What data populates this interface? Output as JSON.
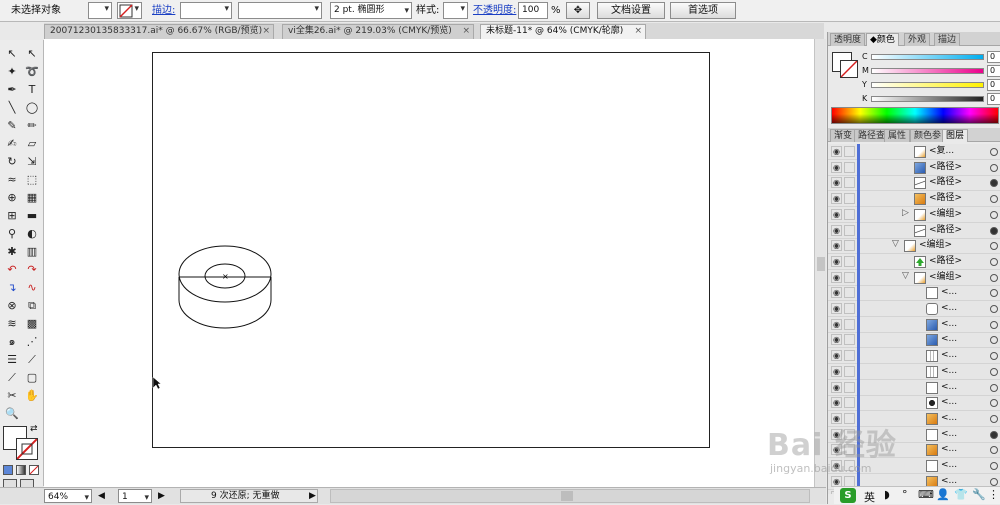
{
  "control_bar": {
    "selection_status": "未选择对象",
    "stroke_label": "描边:",
    "stroke_weight": "",
    "stroke_profile": "",
    "brush_value": "2 pt. 椭圆形",
    "style_label": "样式:",
    "opacity_label": "不透明度:",
    "opacity_value": "100",
    "opacity_unit": "%",
    "doc_setup_button": "文档设置",
    "preferences_button": "首选项"
  },
  "document_tabs": [
    {
      "label": "20071230135833317.ai* @ 66.67% (RGB/预览)",
      "active": false
    },
    {
      "label": "vi全集26.ai* @ 219.03% (CMYK/预览)",
      "active": false
    },
    {
      "label": "未标题-11* @ 64% (CMYK/轮廓)",
      "active": true
    }
  ],
  "tab_close_glyph": "×",
  "tools": [
    {
      "name": "selection-tool-icon",
      "glyph": "↖"
    },
    {
      "name": "direct-selection-tool-icon",
      "glyph": "↖"
    },
    {
      "name": "magic-wand-tool-icon",
      "glyph": "✦"
    },
    {
      "name": "lasso-tool-icon",
      "glyph": "➰"
    },
    {
      "name": "pen-tool-icon",
      "glyph": "✒"
    },
    {
      "name": "type-tool-icon",
      "glyph": "T"
    },
    {
      "name": "line-tool-icon",
      "glyph": "╲"
    },
    {
      "name": "ellipse-tool-icon",
      "glyph": "◯"
    },
    {
      "name": "paintbrush-tool-icon",
      "glyph": "✎"
    },
    {
      "name": "pencil-tool-icon",
      "glyph": "✏"
    },
    {
      "name": "blob-brush-tool-icon",
      "glyph": "✍"
    },
    {
      "name": "eraser-tool-icon",
      "glyph": "▱"
    },
    {
      "name": "rotate-tool-icon",
      "glyph": "↻"
    },
    {
      "name": "scale-tool-icon",
      "glyph": "⇲"
    },
    {
      "name": "warp-tool-icon",
      "glyph": "≈"
    },
    {
      "name": "free-transform-tool-icon",
      "glyph": "⬚"
    },
    {
      "name": "shape-builder-tool-icon",
      "glyph": "⊕"
    },
    {
      "name": "perspective-grid-tool-icon",
      "glyph": "▦"
    },
    {
      "name": "mesh-tool-icon",
      "glyph": "⊞"
    },
    {
      "name": "gradient-tool-icon",
      "glyph": "▬"
    },
    {
      "name": "eyedropper-tool-icon",
      "glyph": "⚲"
    },
    {
      "name": "blend-tool-icon",
      "glyph": "◐"
    },
    {
      "name": "symbol-sprayer-tool-icon",
      "glyph": "✱"
    },
    {
      "name": "column-graph-tool-icon",
      "glyph": "▥"
    },
    {
      "name": "red-shape-tool-icon",
      "glyph": "↶"
    },
    {
      "name": "red-curve-tool-icon",
      "glyph": "↷"
    },
    {
      "name": "blue-path-tool-icon",
      "glyph": "↴"
    },
    {
      "name": "red-wave-tool-icon",
      "glyph": "∿"
    },
    {
      "name": "target-tool-icon",
      "glyph": "⊗"
    },
    {
      "name": "envelope-tool-icon",
      "glyph": "⧉"
    },
    {
      "name": "wave-tool-icon",
      "glyph": "≋"
    },
    {
      "name": "grid-tool-icon",
      "glyph": "▩"
    },
    {
      "name": "spiral-tool-icon",
      "glyph": "๑"
    },
    {
      "name": "wrinkle-tool-icon",
      "glyph": "⋰"
    },
    {
      "name": "list-tool-icon",
      "glyph": "☰"
    },
    {
      "name": "slice-tool-icon",
      "glyph": "⟋"
    },
    {
      "name": "knife-tool-icon",
      "glyph": "⟋"
    },
    {
      "name": "artboard-tool-icon",
      "glyph": "▢"
    },
    {
      "name": "scissors-tool-icon",
      "glyph": "✂"
    },
    {
      "name": "hand-tool-icon",
      "glyph": "✋"
    },
    {
      "name": "zoom-tool-icon",
      "glyph": "🔍"
    }
  ],
  "panel_top_tabs": [
    "透明度",
    "颜色",
    "外观",
    "描边"
  ],
  "panel_top_active": 1,
  "color_channels": [
    {
      "label": "C",
      "value": "0",
      "color": "#00aeef"
    },
    {
      "label": "M",
      "value": "0",
      "color": "#ec008c"
    },
    {
      "label": "Y",
      "value": "0",
      "color": "#fff200"
    },
    {
      "label": "K",
      "value": "0",
      "color": "#222222"
    }
  ],
  "channel_unit": "%",
  "panel_lower_tabs": [
    "渐变",
    "路径查",
    "属性",
    "颜色参",
    "图层"
  ],
  "panel_lower_active": 4,
  "layer_rows": [
    {
      "indent": 0,
      "name": "<复...",
      "thumb": "doc",
      "target": "empty"
    },
    {
      "indent": 0,
      "name": "<路径>",
      "thumb": "blue",
      "target": "empty"
    },
    {
      "indent": 0,
      "name": "<路径>",
      "thumb": "line",
      "target": "filled"
    },
    {
      "indent": 0,
      "name": "<路径>",
      "thumb": "orange",
      "target": "empty"
    },
    {
      "indent": 0,
      "name": "<编组>",
      "thumb": "doc",
      "target": "empty",
      "arrow": "▷"
    },
    {
      "indent": 0,
      "name": "<路径>",
      "thumb": "line",
      "target": "filled"
    },
    {
      "indent": -1,
      "name": "<编组>",
      "thumb": "doc",
      "target": "empty",
      "arrow": "▽"
    },
    {
      "indent": 0,
      "name": "<路径>",
      "thumb": "green",
      "target": "empty"
    },
    {
      "indent": 0,
      "name": "<编组>",
      "thumb": "doc",
      "target": "empty",
      "arrow": "▽"
    },
    {
      "indent": 1,
      "name": "<...",
      "thumb": "blank",
      "target": "empty"
    },
    {
      "indent": 1,
      "name": "<...",
      "thumb": "rounded",
      "target": "empty"
    },
    {
      "indent": 1,
      "name": "<...",
      "thumb": "blue",
      "target": "empty"
    },
    {
      "indent": 1,
      "name": "<...",
      "thumb": "blue",
      "target": "empty"
    },
    {
      "indent": 1,
      "name": "<...",
      "thumb": "bars",
      "target": "empty"
    },
    {
      "indent": 1,
      "name": "<...",
      "thumb": "bars",
      "target": "empty"
    },
    {
      "indent": 1,
      "name": "<...",
      "thumb": "blank",
      "target": "empty"
    },
    {
      "indent": 1,
      "name": "<...",
      "thumb": "dark",
      "target": "empty"
    },
    {
      "indent": 1,
      "name": "<...",
      "thumb": "orange",
      "target": "empty"
    },
    {
      "indent": 1,
      "name": "<...",
      "thumb": "blank",
      "target": "filled"
    },
    {
      "indent": 1,
      "name": "<...",
      "thumb": "orange",
      "target": "empty"
    },
    {
      "indent": 1,
      "name": "<...",
      "thumb": "blank",
      "target": "empty"
    },
    {
      "indent": 1,
      "name": "<...",
      "thumb": "orange",
      "target": "empty"
    },
    {
      "indent": 1,
      "name": "<...",
      "thumb": "orange",
      "target": "empty"
    }
  ],
  "status_bar": {
    "zoom": "64%",
    "artboard_number": "1",
    "undo_status": "9 次还原; 无重做"
  },
  "ime_bar": {
    "mode": "英"
  },
  "watermark": {
    "text": "Bai 经验",
    "url": "jingyan.baidu.com"
  }
}
